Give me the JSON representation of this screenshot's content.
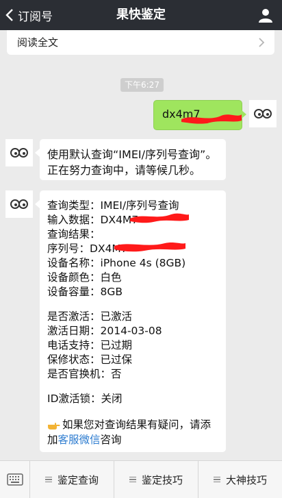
{
  "nav": {
    "back_label": "订阅号",
    "title": "果快鉴定"
  },
  "prev_card": {
    "text": "阅读全文"
  },
  "time": "下午6:27",
  "sent_message": "dx4m7",
  "reply1": {
    "line1": "使用默认查询“IMEI/序列号查询”。",
    "line2": "正在努力查询中，请等候几秒。"
  },
  "reply2": {
    "type_label": "查询类型：",
    "type_value": "IMEI/序列号查询",
    "input_label": "输入数据：",
    "input_value": "DX4M7",
    "result_label": "查询结果：",
    "serial_label": "序列号：",
    "serial_value": "DX4M7",
    "device_label": "设备名称：",
    "device_value": "iPhone 4s (8GB)",
    "color_label": "设备颜色：",
    "color_value": "白色",
    "capacity_label": "设备容量：",
    "capacity_value": "8GB",
    "activated_label": "是否激活：",
    "activated_value": "已激活",
    "activation_date_label": "激活日期：",
    "activation_date_value": "2014-03-08",
    "phone_support_label": "电话支持：",
    "phone_support_value": "已过期",
    "warranty_label": "保修状态：",
    "warranty_value": "已过保",
    "replacement_label": "是否官换机：",
    "replacement_value": "否",
    "idlock_label": "ID激活锁：",
    "idlock_value": "关闭",
    "note_line1": "如果您对查询结果有疑问，请添",
    "note_prefix": "加",
    "note_link": "客服微信",
    "note_suffix": "咨询"
  },
  "menu": [
    "鉴定查询",
    "鉴定技巧",
    "大神技巧"
  ],
  "colors": {
    "navbar": "#2b2e34",
    "bubble_green": "#9fe55e",
    "link": "#2d7cd0",
    "redaction": "#ff1a1a"
  }
}
